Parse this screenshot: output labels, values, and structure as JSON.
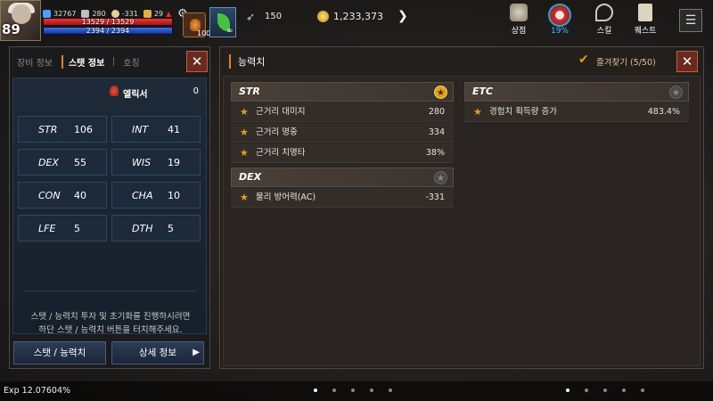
{
  "hud": {
    "level": "89",
    "power": "32767",
    "atk": "280",
    "def": "-331",
    "trophy": "29",
    "hp": "13529 / 13529",
    "mp": "2394 / 2394",
    "potion_count": "100",
    "leaf_count": "∞",
    "feather": "150",
    "gold": "1,233,373",
    "shop_label": "상점",
    "event_pct": "19%",
    "skill_label": "스킬",
    "quest_label": "퀘스트"
  },
  "left": {
    "tabs": [
      "장비 정보",
      "스탯 정보",
      "호칭"
    ],
    "elixir_label": "엘릭서",
    "elixir_value": "0",
    "stats": [
      {
        "name": "STR",
        "value": "106"
      },
      {
        "name": "INT",
        "value": "41"
      },
      {
        "name": "DEX",
        "value": "55"
      },
      {
        "name": "WIS",
        "value": "19"
      },
      {
        "name": "CON",
        "value": "40"
      },
      {
        "name": "CHA",
        "value": "10"
      },
      {
        "name": "LFE",
        "value": "5"
      },
      {
        "name": "DTH",
        "value": "5"
      }
    ],
    "hint_line1": "스탯 / 능력치 투자 및 초기화를 진행하시려면",
    "hint_line2": "하단 스탯 / 능력치 버튼을 터치해주세요.",
    "btn_stat": "스탯 / 능력치",
    "btn_detail": "상세 정보"
  },
  "right": {
    "title": "능력치",
    "favorites": "즐겨찾기 (5/50)",
    "groups": {
      "str": {
        "name": "STR",
        "rows": [
          {
            "name": "근거리 대미지",
            "value": "280"
          },
          {
            "name": "근거리 명중",
            "value": "334"
          },
          {
            "name": "근거리 치명타",
            "value": "38%"
          }
        ]
      },
      "dex": {
        "name": "DEX",
        "rows": [
          {
            "name": "물리 방어력(AC)",
            "value": "-331"
          }
        ]
      },
      "etc": {
        "name": "ETC",
        "rows": [
          {
            "name": "경험치 획득량 증가",
            "value": "483.4%"
          }
        ]
      }
    }
  },
  "footer": {
    "exp": "Exp 12.07604%"
  }
}
